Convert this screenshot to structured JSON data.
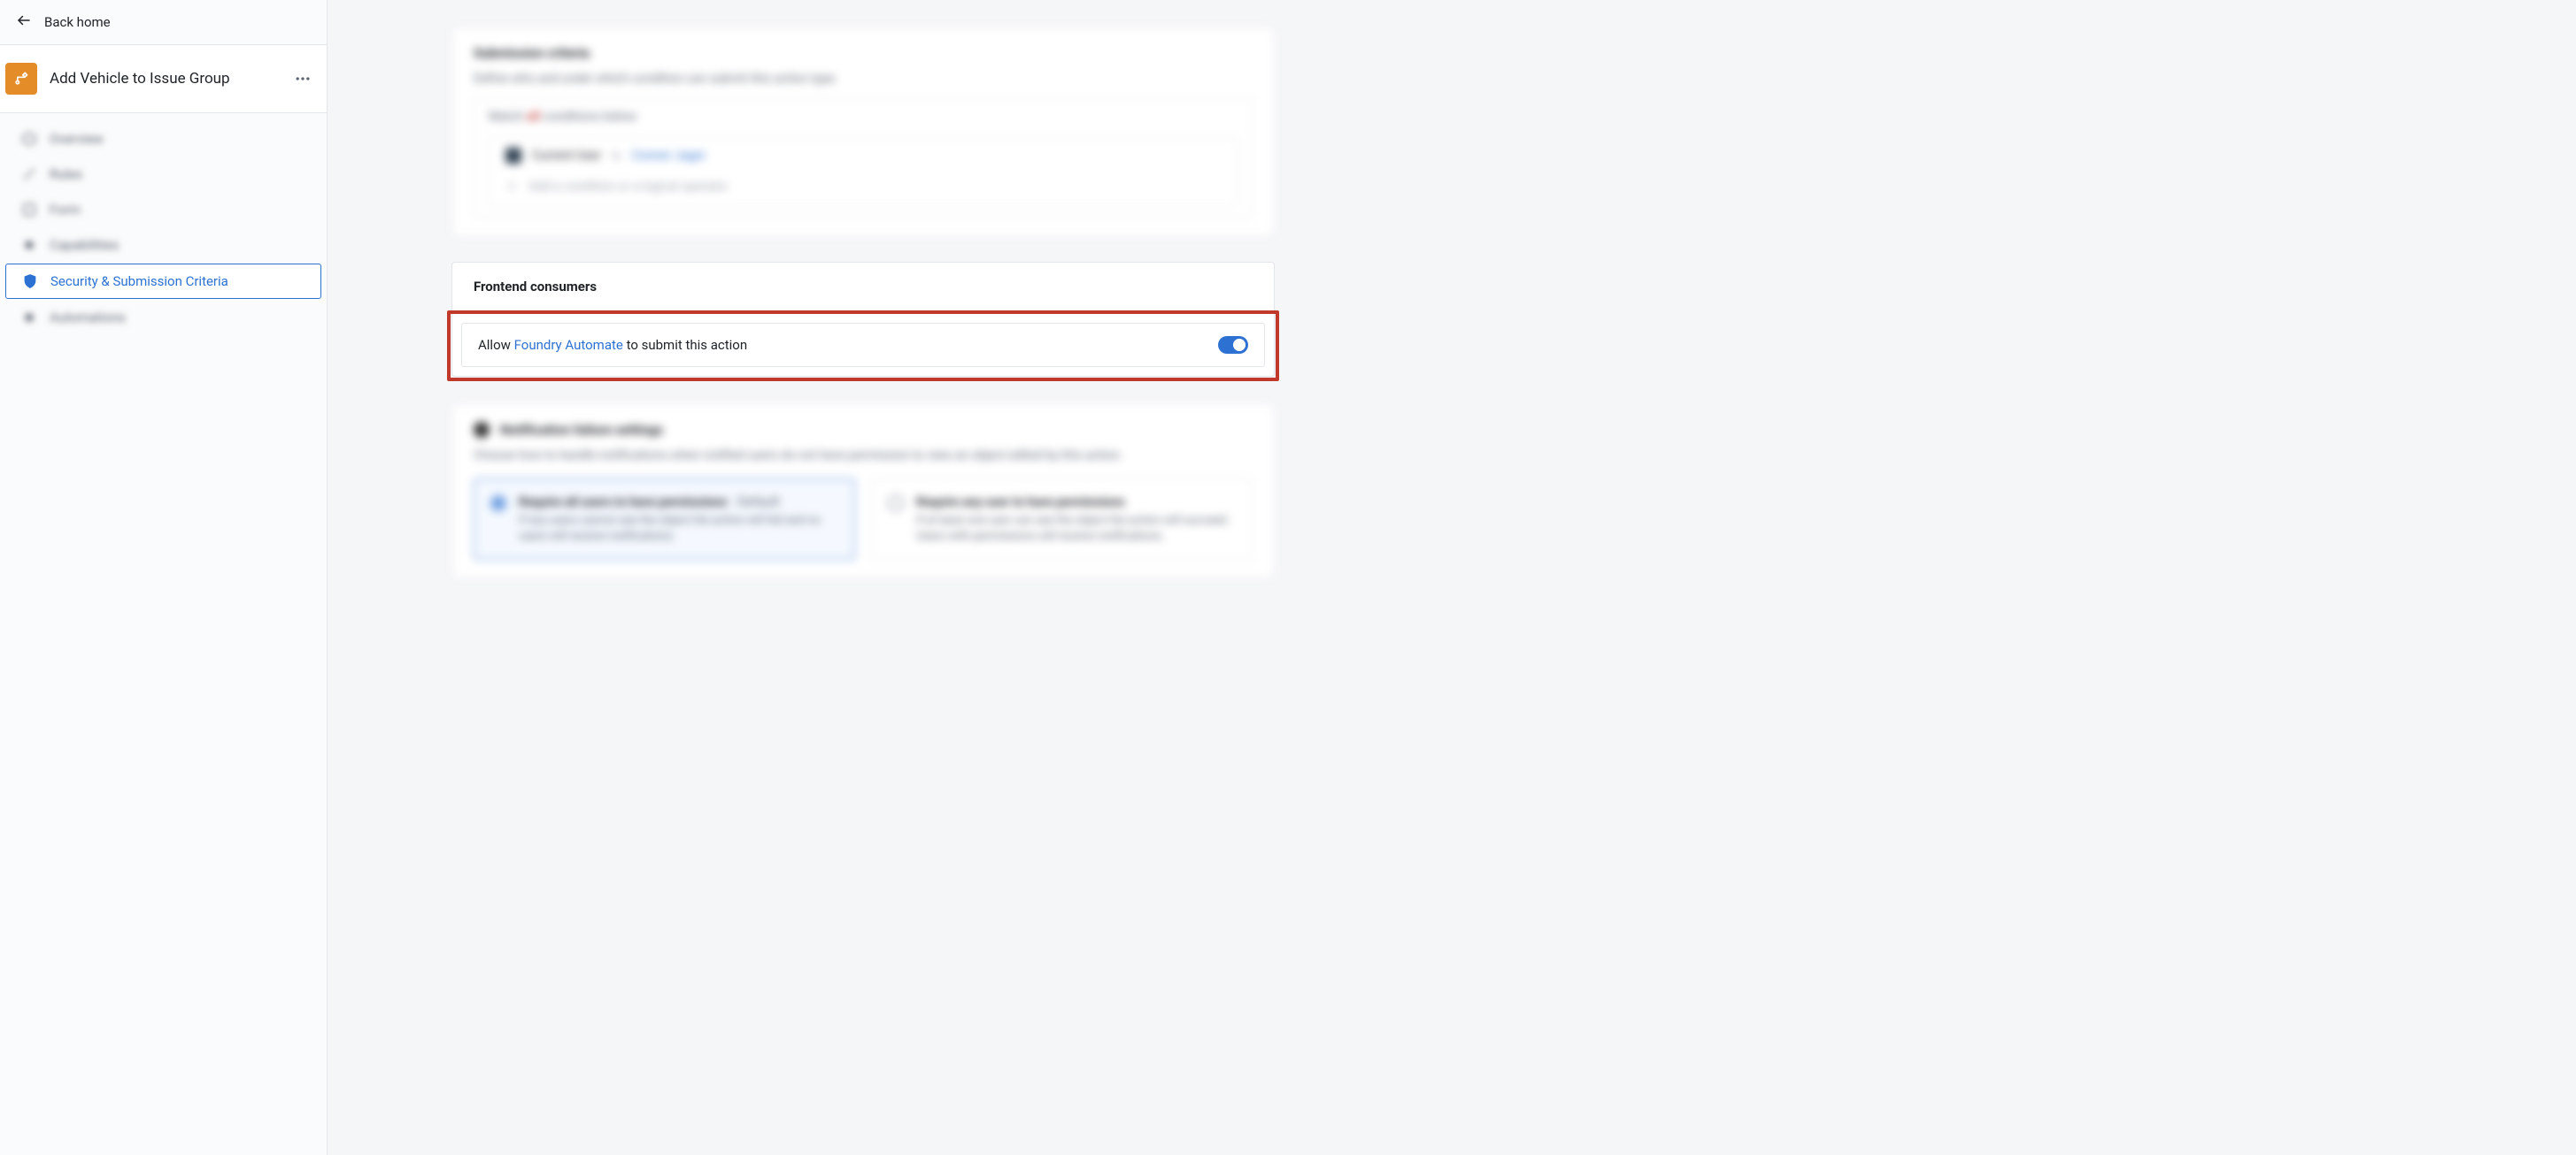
{
  "back_label": "Back home",
  "page_title": "Add Vehicle to Issue Group",
  "sidebar": {
    "items": [
      {
        "label": "Overview"
      },
      {
        "label": "Rules"
      },
      {
        "label": "Form"
      },
      {
        "label": "Capabilities"
      },
      {
        "label": "Security & Submission Criteria"
      },
      {
        "label": "Automations"
      }
    ]
  },
  "submission": {
    "title": "Submission criteria",
    "description": "Define who and under which condition can submit this action type.",
    "match_prefix": "Match",
    "match_em": "all",
    "match_suffix": "conditions below",
    "current_user_label": "Current User",
    "is_label": "is",
    "user_name": "Conner Jager",
    "add_condition": "Add a condition or a logical operator"
  },
  "frontend": {
    "title": "Frontend consumers",
    "allow_prefix": "Allow ",
    "allow_link": "Foundry Automate",
    "allow_suffix": " to submit this action",
    "enabled": true
  },
  "notification": {
    "title": "Notification failure settings",
    "description": "Choose how to handle notifications when notified users do not have permission to view an object edited by this action.",
    "options": [
      {
        "title": "Require all users to have permissions",
        "default_label": " · Default",
        "desc": "If any users cannot see the object the action will fail and no users will receive notifications."
      },
      {
        "title": "Require any user to have permissions",
        "default_label": "",
        "desc": "If at least one user can see the object the action will succeed. Users with permissions will receive notifications."
      }
    ]
  }
}
